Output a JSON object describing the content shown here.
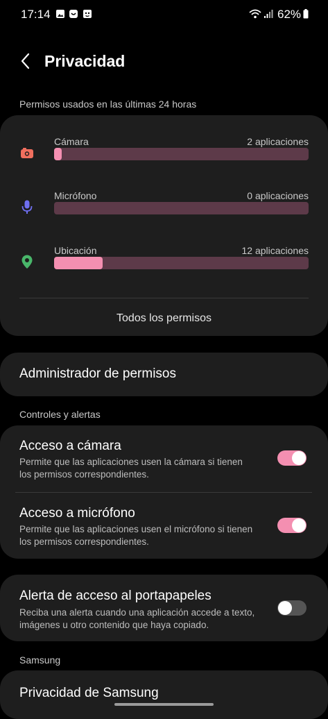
{
  "status_bar": {
    "time": "17:14",
    "battery": "62%",
    "icons": [
      "gallery-icon",
      "messenger-icon",
      "face-app-icon",
      "wifi-icon",
      "signal-icon",
      "battery-icon"
    ]
  },
  "header": {
    "title": "Privacidad",
    "back_icon": "chevron-left-icon"
  },
  "usage": {
    "section_label": "Permisos usados en las últimas 24 horas",
    "rows": [
      {
        "label": "Cámara",
        "count": "2 aplicaciones",
        "fill_fraction": 0.03,
        "icon": "camera-icon",
        "color": "#f06f5e"
      },
      {
        "label": "Micrófono",
        "count": "0 aplicaciones",
        "fill_fraction": 0.0,
        "icon": "microphone-icon",
        "color": "#6f6ff0"
      },
      {
        "label": "Ubicación",
        "count": "12 aplicaciones",
        "fill_fraction": 0.19,
        "icon": "location-icon",
        "color": "#49b66a"
      }
    ],
    "all_permissions": "Todos los permisos"
  },
  "permission_manager": {
    "label": "Administrador de permisos"
  },
  "controls": {
    "section_label": "Controles y alertas",
    "items": [
      {
        "title": "Acceso a cámara",
        "desc": "Permite que las aplicaciones usen la cámara si tienen los permisos correspondientes.",
        "enabled": true
      },
      {
        "title": "Acceso a micrófono",
        "desc": "Permite que las aplicaciones usen el micrófono si tienen los permisos correspondientes.",
        "enabled": true
      }
    ]
  },
  "clipboard": {
    "title": "Alerta de acceso al portapapeles",
    "desc": "Reciba una alerta cuando una aplicación accede a texto, imágenes u otro contenido que haya copiado.",
    "enabled": false
  },
  "samsung": {
    "section_label": "Samsung",
    "item": "Privacidad de Samsung"
  },
  "colors": {
    "accent": "#f48fb1",
    "track": "#5d3a49",
    "card": "#1e1e1e",
    "background": "#000000"
  }
}
